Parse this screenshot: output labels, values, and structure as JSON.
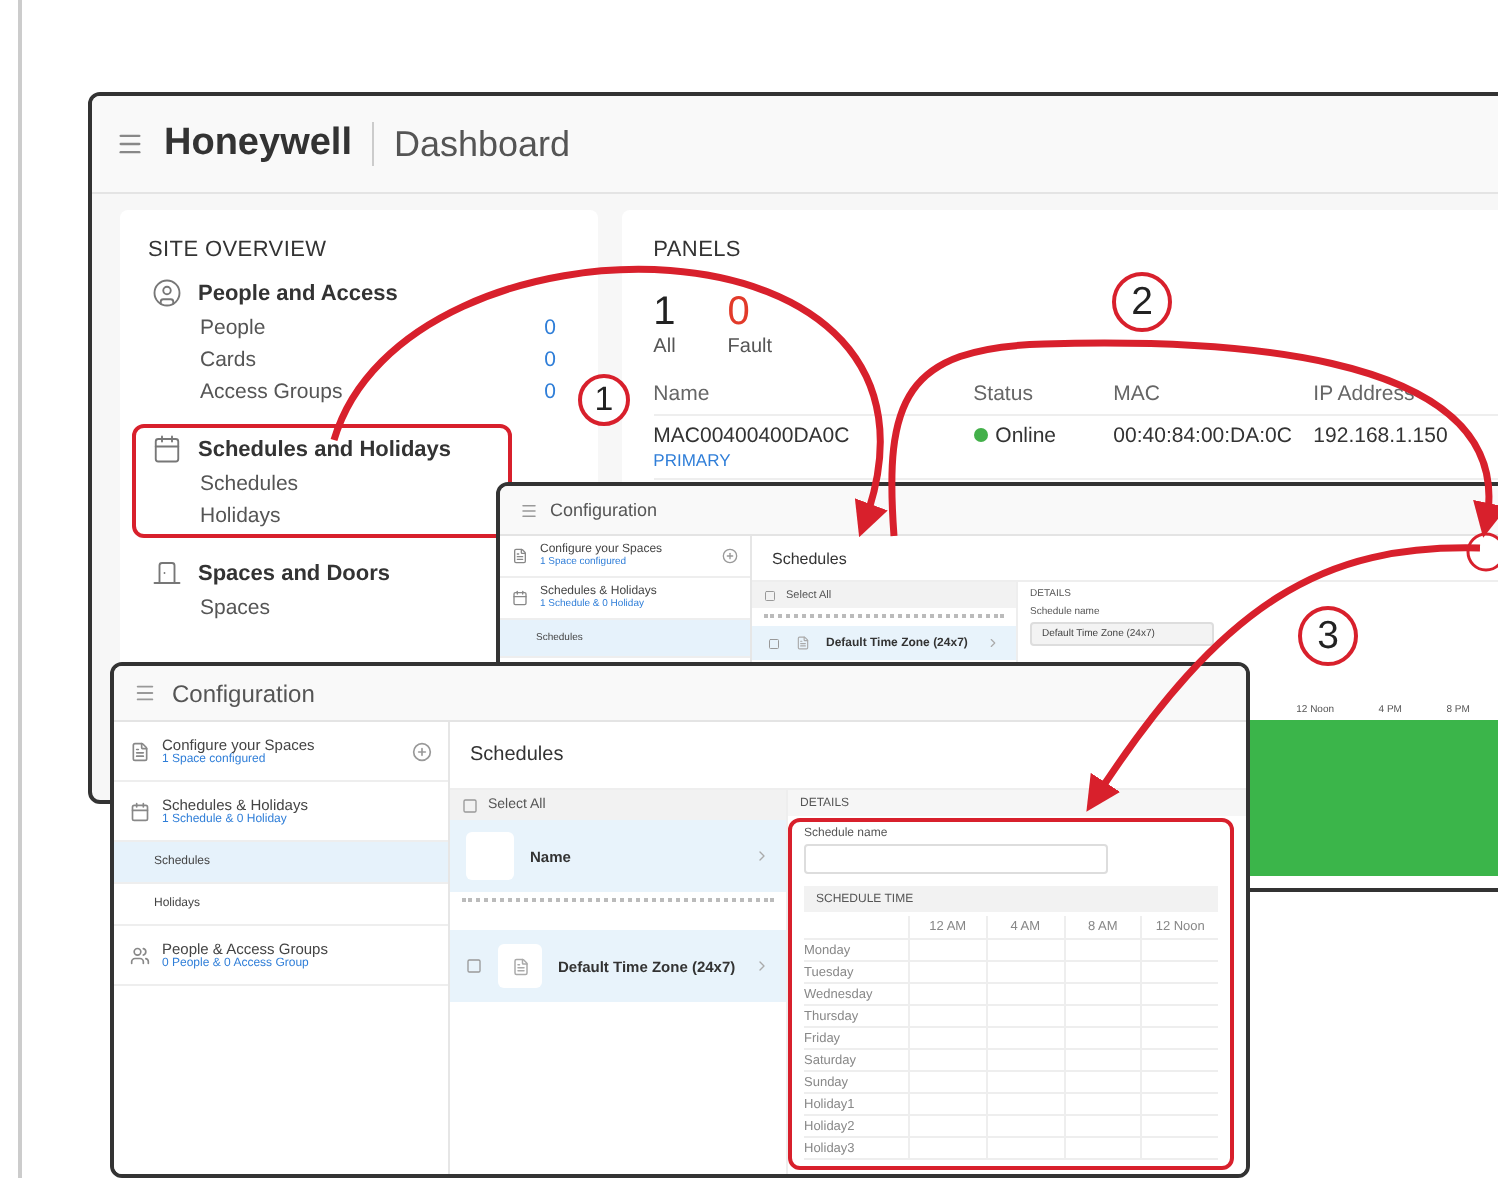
{
  "dashboard": {
    "brand": "Honeywell",
    "title": "Dashboard",
    "site_overview": {
      "heading": "SITE OVERVIEW",
      "groups": [
        {
          "kind": "person",
          "title": "People and Access",
          "highlighted": false,
          "items": [
            {
              "label": "People",
              "count": "0"
            },
            {
              "label": "Cards",
              "count": "0"
            },
            {
              "label": "Access Groups",
              "count": "0"
            }
          ]
        },
        {
          "kind": "calendar",
          "title": "Schedules and Holidays",
          "highlighted": true,
          "items": [
            {
              "label": "Schedules"
            },
            {
              "label": "Holidays"
            }
          ]
        },
        {
          "kind": "door",
          "title": "Spaces and Doors",
          "highlighted": false,
          "items": [
            {
              "label": "Spaces"
            }
          ]
        }
      ]
    },
    "panels": {
      "heading": "PANELS",
      "stats": [
        {
          "value": "1",
          "label": "All",
          "kind": "normal"
        },
        {
          "value": "0",
          "label": "Fault",
          "kind": "fault"
        }
      ],
      "columns": [
        "Name",
        "Status",
        "MAC",
        "IP Address"
      ],
      "rows": [
        {
          "name": "MAC00400400DA0C",
          "tag": "PRIMARY",
          "status": "Online",
          "mac": "00:40:84:00:DA:0C",
          "ip": "192.168.1.150"
        }
      ]
    }
  },
  "config_back": {
    "title": "Configuration",
    "sidebar": [
      {
        "kind": "section",
        "title": "Configure your Spaces",
        "subtitle": "1 Space configured",
        "add": true
      },
      {
        "kind": "section",
        "title": "Schedules & Holidays",
        "subtitle": "1 Schedule & 0 Holiday",
        "add": false
      },
      {
        "kind": "sub",
        "title": "Schedules",
        "selected": true
      }
    ],
    "main_title": "Schedules",
    "select_all": {
      "label": "Select All",
      "checked": false
    },
    "details_heading": "DETAILS",
    "field_label": "Schedule name",
    "field_value": "Default Time Zone (24x7)",
    "rows": [
      {
        "name": "Default Time Zone (24x7)",
        "checked": false
      }
    ],
    "time_columns": [
      "12 Noon",
      "4 PM",
      "8 PM"
    ]
  },
  "config_front": {
    "title": "Configuration",
    "sidebar": [
      {
        "kind": "section",
        "title": "Configure your Spaces",
        "subtitle": "1 Space configured",
        "add": true
      },
      {
        "kind": "section",
        "title": "Schedules & Holidays",
        "subtitle": "1 Schedule & 0 Holiday",
        "add": false
      },
      {
        "kind": "sub",
        "title": "Schedules",
        "selected": true
      },
      {
        "kind": "sub",
        "title": "Holidays",
        "selected": false
      },
      {
        "kind": "section",
        "title": "People & Access Groups",
        "subtitle": "0 People & 0 Access Group",
        "add": false
      }
    ],
    "main_title": "Schedules",
    "select_all": {
      "label": "Select All",
      "checked": false
    },
    "rows": [
      {
        "kind": "header",
        "name": "Name"
      },
      {
        "kind": "item",
        "name": "Default Time Zone (24x7)",
        "checked": false
      }
    ],
    "details_heading": "DETAILS",
    "field_label": "Schedule name",
    "schedule_heading": "SCHEDULE TIME",
    "time_columns": [
      "12 AM",
      "4 AM",
      "8 AM",
      "12 Noon"
    ],
    "days": [
      "Monday",
      "Tuesday",
      "Wednesday",
      "Thursday",
      "Friday",
      "Saturday",
      "Sunday",
      "Holiday1",
      "Holiday2",
      "Holiday3"
    ]
  },
  "callouts": [
    "1",
    "2",
    "3"
  ]
}
